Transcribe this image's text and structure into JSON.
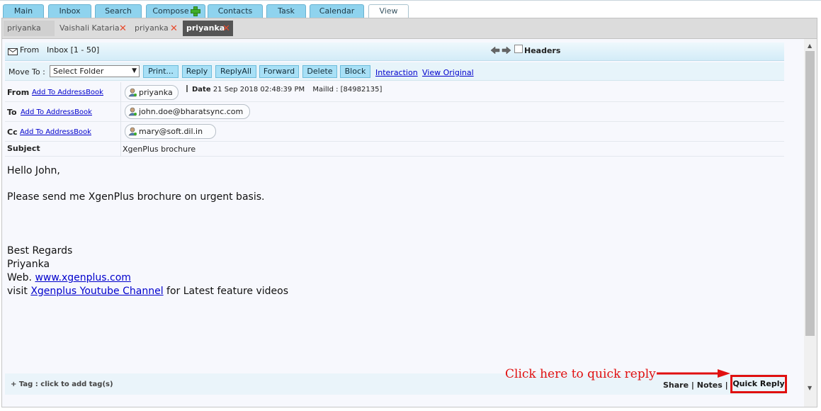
{
  "top_tabs": [
    "Main",
    "Inbox",
    "Search",
    "Compose",
    "Contacts",
    "Task",
    "Calendar",
    "View"
  ],
  "sub_tabs": [
    "priyanka",
    "Vaishali Kataria",
    "priyanka",
    "priyanka"
  ],
  "header": {
    "from_label": "From",
    "folder_info": "Inbox [1 - 50]",
    "headers_label": "Headers"
  },
  "actions": {
    "move_to_label": "Move To :",
    "folder_select_value": "Select Folder",
    "buttons": [
      "Print...",
      "Reply",
      "ReplyAll",
      "Forward",
      "Delete",
      "Block"
    ],
    "links": [
      "Interaction",
      "View Original"
    ]
  },
  "fields": {
    "from_label": "From",
    "to_label": "To",
    "cc_label": "Cc",
    "subject_label": "Subject",
    "add_to_addressbook": "Add To AddressBook",
    "from_value": "priyanka",
    "to_value": "john.doe@bharatsync.com",
    "cc_value": "mary@soft.dil.in",
    "subject_value": "XgenPlus brochure",
    "date_label": "Date",
    "date_value": "21 Sep 2018 02:48:39 PM",
    "mailid_text": "MailId : [84982135]"
  },
  "body": {
    "greeting": "Hello John,",
    "message": "Please send me XgenPlus brochure on urgent basis.",
    "regards": "Best Regards",
    "name": "Priyanka",
    "web_label": "Web.",
    "web_link": "www.xgenplus.com",
    "visit_label": "visit",
    "youtube_link": "Xgenplus Youtube Channel",
    "visit_suffix": "for Latest feature videos"
  },
  "footer": {
    "tag_text": "+ Tag : click to add tag(s)",
    "annotation": "Click here to quick reply",
    "share": "Share",
    "notes": "Notes",
    "sep": "|",
    "quick_reply": "Quick Reply"
  }
}
